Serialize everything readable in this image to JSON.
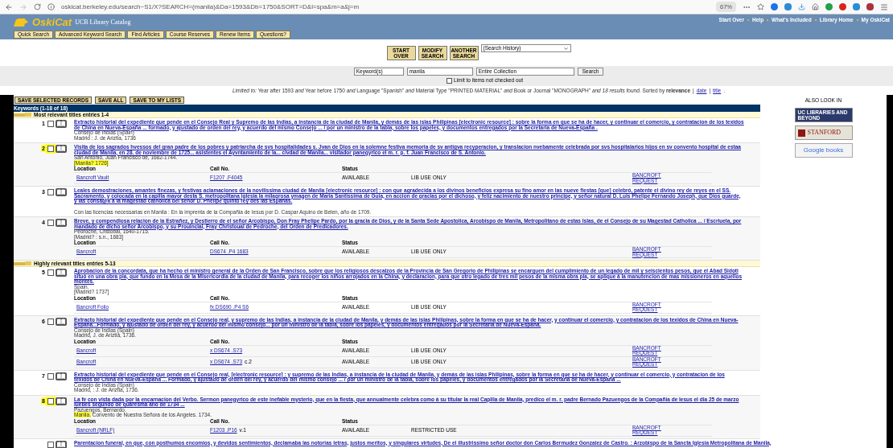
{
  "browser": {
    "url": "oskicat.berkeley.edu/search~S1/X?SEARCH=(manila)&Da=1593&Db=1750&SORT=D&l=spa&m=a&j=m",
    "zoom": "67%"
  },
  "header": {
    "logo": "OskiCat",
    "subtitle": "UCB Library Catalog",
    "links": [
      "Start Over",
      "Help",
      "What's Included",
      "Library Home",
      "My OskiCat"
    ],
    "tabs": [
      "Quick Search",
      "Advanced Keyword Search",
      "Find Articles",
      "Course Reserves",
      "Renew Items",
      "Questions?"
    ]
  },
  "actions": [
    "START OVER",
    "MODIFY SEARCH",
    "ANOTHER SEARCH"
  ],
  "history_select": "(Search History)",
  "search": {
    "field": "Keyword(s)",
    "query": "manila",
    "scope": "Entire Collection",
    "button": "Search",
    "limit_label": "Limit to items not checked out",
    "limit_checked": false
  },
  "limits": "*Limited to:* Year after 1593 *and* Year before 1750 *and* Language \"Spanish\" *and* Material Type \"PRINTED MATERIAL\" *and* Book or Journal \"MONOGRAPH\" *and 18 results found.* Sorted by **relevance**",
  "sort_separator": "|",
  "sort_links": [
    "date",
    "title"
  ],
  "sort_end": ".",
  "save_buttons": [
    "SAVE SELECTED RECORDS",
    "SAVE ALL",
    "SAVE TO MY LISTS"
  ],
  "results_title": "Keywords (1-18 of 18)",
  "groups": [
    {
      "label": "Most relevant titles entries 1-4",
      "records": [
        {
          "number": "1",
          "checked": false,
          "highlighted": false,
          "title": "Extracto historial del expediente que pende en el Consejo Real y Supremo de las Indias, a instancia de la ciudad de Manila, y demás de las islas Philipinas [electronic resource] : sobre la forma en que se ha de hacer, y continuar el comercio, y contratacion de los texidos de China en Nueva-España ... formado, y ajustado de orden del rey, y acuerdo del mismo Consejo ... / por un ministro de la tabla, sobre los papeles, y documentos entregados por la Secretaria de Nueva-España .",
          "author": "Consejo de Indias (Spain)",
          "imprint": [
            {
              "text": "Madrid : J. de Ariztia, 1736",
              "highlighted": false
            }
          ]
        },
        {
          "number": "2",
          "checked": false,
          "highlighted": true,
          "title": "Visita de los sagrados hvessos del gran padre de los pobres y patriarcha de svs hospitalidades s. Jvan de Dios en la solemne festiva memoria de sv antigva recyperacion, y translacion nvebamente celebrada por svs hospitalarios hijos en sv convento hospital de estaa ciudad de Manila, en 28. de noviembre de 1725... asistentes el Ayvntamiento de la... civdad de Manila... visitador panegyrico el m. r. p. f. Juan Francisco de S. Antonio.",
          "author": "San Antonio, Juan Francisco de, 1682-1744.",
          "imprint": [
            {
              "text": "[Manila? 1726]",
              "highlighted": true
            }
          ],
          "columns": [
            "Location",
            "Call No.",
            "Status"
          ],
          "holdings": [
            {
              "location": "Bancroft Vault",
              "call_no": "F1207 .F4045",
              "status": "AVAILABLE",
              "use": "LIB USE ONLY",
              "request": "BANCROFT REQUEST"
            }
          ]
        },
        {
          "number": "3",
          "checked": false,
          "highlighted": false,
          "title": "Leales demostraciones, amantes finezas, y festivas aclamaciones de la novilissima ciudad de Manila [electronic resource] : con que agradecida a los divinos beneficios expresa su fino amor en las nueve fiestas [que] celebró, patente el divino rey de reyes en el SS. Sacramento, y colocada en la capilla mayor desta S. metropolitana iglesia la milagrosa ymagen de Maria Santissima de Guia, en accion de gracias por el dichoso, y feliz nacimiento de nuestro principe, y señor natural D. Luis Phelipe Fernando Joseph, que Dios guarde, y las consagra a la magestad catholica del señor D. Phelipe quinto rey des las Españas.",
          "imprint": [
            {
              "text": "Con las licencias necessarias en Manila : En la imprenta de la Compañia de Iesus por D. Caspar Aquino de Belen, año de 1709.",
              "highlighted": false
            }
          ]
        },
        {
          "number": "4",
          "checked": false,
          "highlighted": false,
          "title": "Breve, y compendiosa relacion de la Estrañez, y Destierro de el señor Arcobispo, Don Fray Phelipe Pardo, por la gracia de Dios, y de la Santa Sede Apostolica, Arcobispo de Manila, Metropolitano de estas Islas, de el Consejo de su Magestad Catholica ... / Escriuela, por mandado de dicho señor Arcobispo, y su Prouincial, Fray Christoual de Pedroche, del Orden de Predicadores.",
          "author": "Pedroche, Cristóbal, 1640-1715.",
          "imprint": [
            {
              "text": "[Madrid? : s.n., 1683]",
              "highlighted": false
            }
          ],
          "columns": [
            "Location",
            "Call No.",
            "Status"
          ],
          "holdings": [
            {
              "location": "Bancroft",
              "call_no": "DS674 .P4 1683",
              "status": "AVAILABLE",
              "use": "LIB USE ONLY",
              "request": "BANCROFT REQUEST"
            }
          ]
        }
      ]
    },
    {
      "label": "Highly relevant titles entries 5-13",
      "records": [
        {
          "number": "5",
          "checked": false,
          "highlighted": false,
          "title": "Aprobacion de la concordata, que ha hecho el ministro general de la Orden de San Francisco, sobre que los religiosos descalzos de la Provincia de San Gregorio de Philipinas se encarguen del cumplimiento de un legado de mil y seiscientos pesos, que el Abad Sidoti situó en una obra pia, que fundo en la Mesa de la Misericordia de la ciudad de Manila, para recoger los niños arrojados en la China, y declaracion, para que otro legado de tres mil pesos de la misma obra pia, se aplique á la manutencion de mas missioneros en aquellos montes.",
          "author": "Spain.",
          "imprint": [
            {
              "text": "[Madrid? 1737]",
              "highlighted": false
            }
          ],
          "columns": [
            "Location",
            "Call No.",
            "Status"
          ],
          "holdings": [
            {
              "location": "Bancroft Folio",
              "call_no": "fx DS690 .P4 S6",
              "status": "AVAILABLE",
              "use": "LIB USE ONLY",
              "request": "BANCROFT REQUEST"
            }
          ]
        },
        {
          "number": "6",
          "checked": false,
          "highlighted": false,
          "title": "Extracto historial del expediente que pende en el Consejo real, y supremo de las Indias, a instancia de la ciudad de Manila, y demás de las islas Philipinas, sobre la forma en que se ha de hacer, y continuar el comercio, y contratacion de los texidos de China en Nueva-España...Formado, y ajustado de orden del rey, y acuerdo del mismo consejo... por un ministro de la tabla, sobre los papeles, y documentos entregados por la Secretaria de Nueva-España.",
          "author": "Consejo de Indias (Spain)",
          "imprint": [
            {
              "text": "Madrid, J. de Ariztia, 1736.",
              "highlighted": false
            }
          ],
          "columns": [
            "Location",
            "Call No.",
            "Status"
          ],
          "holdings": [
            {
              "location": "Bancroft",
              "call_no": "x DS674 .S73",
              "status": "AVAILABLE",
              "use": "LIB USE ONLY",
              "request": "BANCROFT REQUEST"
            },
            {
              "location": "Bancroft",
              "call_no": "x DS674 .S73",
              "copy": "c.2",
              "status": "AVAILABLE",
              "use": "LIB USE ONLY",
              "request": "BANCROFT REQUEST"
            }
          ]
        },
        {
          "number": "7",
          "checked": false,
          "highlighted": false,
          "title": "Extracto historial del expediente que pende en el Consejo real, [electronic resource] : y supremo de las Indias, a instancia de la ciudad de Manila, y demás de las islas Philipinas, sobre la forma en que se ha de hacer, y continuar el comercio, y contratacion de los texidos de China en Nueva-España ... Formado, y ajustado de orden del rey, y acuerdo del mismo consejo ... / por un ministro de la tabla, sobre los papeles, y documentos entregados por la Secretaria de Nueva-España ...",
          "author": "Consejo de Indias (Spain)",
          "imprint": [
            {
              "text": "Madrid, : J. de Ariztia, 1736.",
              "highlighted": false
            }
          ]
        },
        {
          "number": "8",
          "checked": false,
          "highlighted": true,
          "title": "La fe con vista dada por la encarnacion del Verbo. Sermon panegyrico de este inefable mysterio, que en la fiesta, que annualmente celebra como á su titular la real Capilla de Manila, predico el m. r. padre Bernado Pazuengos de la Compañia de Iesus el dia 25 de marzo iuebes segundo de quaresma año de 1734 ...",
          "author": "Pazuengos, Bernardo.",
          "imprint": [
            {
              "text": "Manila.",
              "highlighted": true
            },
            {
              "text": " Convento de Nuestra Señora de los Angeles. 1734.",
              "highlighted": false
            }
          ],
          "columns": [
            "Location",
            "Call No.",
            "Status"
          ],
          "holdings": [
            {
              "location": "Bancroft (NRLF)",
              "call_no": "F1203 .P16",
              "copy": "v.1",
              "status": "AVAILABLE",
              "use": "RESTRICTED USE",
              "request": "BANCROFT REQUEST"
            }
          ]
        },
        {
          "checked": false,
          "highlighted": false,
          "title": "Parentacion funeral, en que, con posthumos encomios, y devidos sentimientos, declamaba las notorias letras, justos meritos, y singulares virtudes, De el illustrissimo señor doctor don Carlos Bermudez Gonzalez de Castro. : Arzobispo de la Sancta Iglesia Metropolitana de Manila,"
        }
      ]
    }
  ],
  "also_look_in": {
    "label": "ALSO LOOK IN",
    "sources": [
      {
        "kind": "uc",
        "label": "UC LIBRARIES AND BEYOND"
      },
      {
        "kind": "stanford",
        "label": "STANFORD"
      },
      {
        "kind": "google",
        "label": "Google books"
      }
    ]
  }
}
